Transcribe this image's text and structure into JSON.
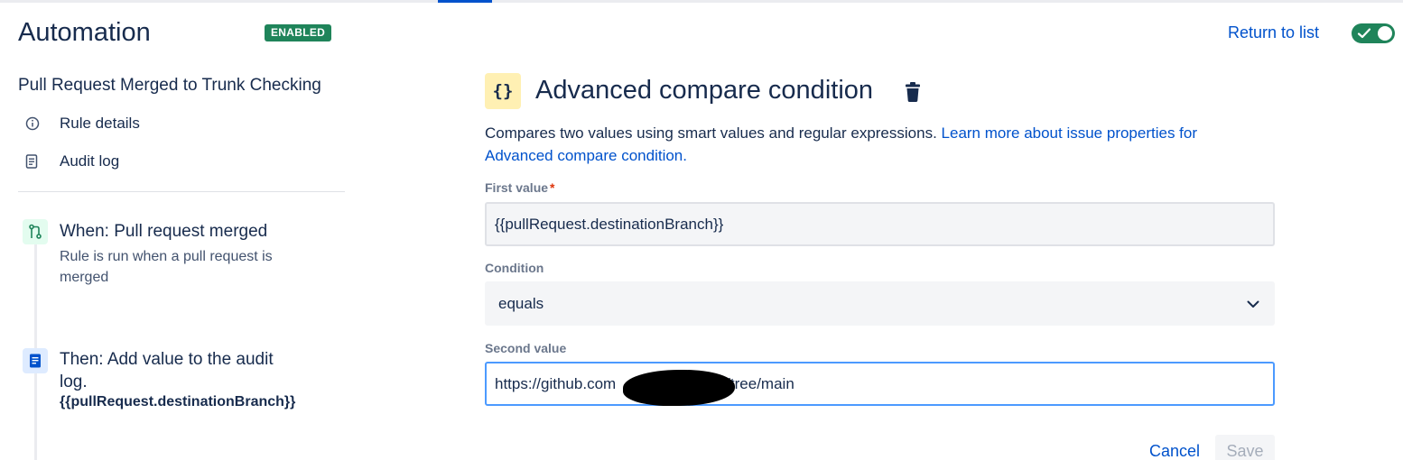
{
  "header": {
    "app_title": "Automation",
    "status_badge": "ENABLED",
    "return_link": "Return to list",
    "toggle_on": true
  },
  "sidebar": {
    "rule_name": "Pull Request Merged to Trunk Checking",
    "nav": [
      {
        "label": "Rule details",
        "icon": "info-icon"
      },
      {
        "label": "Audit log",
        "icon": "document-icon"
      }
    ],
    "steps": [
      {
        "title": "When: Pull request merged",
        "description": "Rule is run when a pull request is merged",
        "icon": "git-pull-request-icon",
        "icon_color": "#1f845a"
      },
      {
        "title": "Then: Add value to the audit log.",
        "value": "{{pullRequest.destinationBranch}}",
        "icon": "document-icon",
        "icon_color": "#0052cc"
      }
    ]
  },
  "main": {
    "icon_text": "{}",
    "title": "Advanced compare condition",
    "description": "Compares two values using smart values and regular expressions.",
    "learn_more_link": "Learn more about issue properties for Advanced compare condition.",
    "fields": {
      "first_label": "First value",
      "required_marker": "*",
      "first_value": "{{pullRequest.destinationBranch}}",
      "condition_label": "Condition",
      "condition_value": "equals",
      "second_label": "Second value",
      "second_value_prefix": "https://github.com",
      "second_value_suffix": "/tree/main"
    },
    "buttons": {
      "cancel": "Cancel",
      "save": "Save"
    }
  },
  "colors": {
    "accent": "#0052cc",
    "enabled": "#1f845a",
    "text": "#172b4d",
    "subtle": "#6b778c"
  }
}
